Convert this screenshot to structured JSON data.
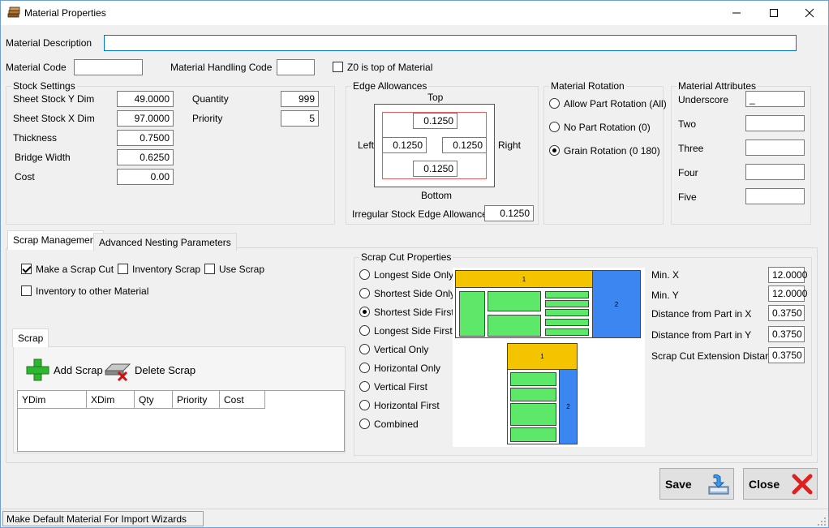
{
  "window": {
    "title": "Material Properties"
  },
  "material": {
    "description_label": "Material Description",
    "description_value": "",
    "code_label": "Material Code",
    "code_value": "",
    "handling_label": "Material Handling Code",
    "handling_value": "",
    "z0_label": "Z0 is top of Material"
  },
  "stock": {
    "title": "Stock Settings",
    "y_dim_label": "Sheet Stock Y Dim",
    "y_dim": "49.0000",
    "x_dim_label": "Sheet Stock X Dim",
    "x_dim": "97.0000",
    "thickness_label": "Thickness",
    "thickness": "0.7500",
    "bridge_label": "Bridge Width",
    "bridge": "0.6250",
    "cost_label": "Cost",
    "cost": "0.00",
    "quantity_label": "Quantity",
    "quantity": "999",
    "priority_label": "Priority",
    "priority": "5"
  },
  "edge": {
    "title": "Edge Allowances",
    "top_label": "Top",
    "bottom_label": "Bottom",
    "left_label": "Left",
    "right_label": "Right",
    "top": "0.1250",
    "left": "0.1250",
    "right": "0.1250",
    "bottom": "0.1250",
    "irregular_label": "Irregular Stock Edge Allowance",
    "irregular": "0.1250"
  },
  "rotation": {
    "title": "Material Rotation",
    "options": [
      "Allow Part Rotation (All)",
      "No Part Rotation (0)",
      "Grain Rotation (0 180)"
    ]
  },
  "attributes": {
    "title": "Material Attributes",
    "labels": [
      "Underscore",
      "Two",
      "Three",
      "Four",
      "Five"
    ],
    "values": [
      "_",
      "",
      "",
      "",
      ""
    ]
  },
  "tabs": [
    "Scrap Management",
    "Advanced Nesting Parameters"
  ],
  "scrap_mgmt": {
    "make_scrap_cut": "Make a Scrap Cut",
    "inventory_scrap": "Inventory Scrap",
    "use_scrap": "Use Scrap",
    "inventory_other": "Inventory to other Material",
    "scrap_tab": "Scrap",
    "add_scrap": "Add Scrap",
    "delete_scrap": "Delete Scrap",
    "columns": [
      "YDim",
      "XDim",
      "Qty",
      "Priority",
      "Cost"
    ]
  },
  "scrap_cut": {
    "title": "Scrap Cut Properties",
    "options": [
      "Longest Side Only",
      "Shortest Side Only",
      "Shortest Side First",
      "Longest Side First",
      "Vertical Only",
      "Horizontal Only",
      "Vertical First",
      "Horizontal First",
      "Combined"
    ],
    "diagram_labels": {
      "a1": "1",
      "a2": "2",
      "b1": "1",
      "b2": "2"
    },
    "min_x_label": "Min. X",
    "min_x": "12.0000",
    "min_y_label": "Min. Y",
    "min_y": "12.0000",
    "dist_x_label": "Distance from Part in X",
    "dist_x": "0.3750",
    "dist_y_label": "Distance from Part in Y",
    "dist_y": "0.3750",
    "ext_label": "Scrap Cut Extension Distance",
    "ext": "0.3750"
  },
  "buttons": {
    "save": "Save",
    "close": "Close"
  },
  "status": {
    "text": "Make Default Material For Import Wizards"
  },
  "colors": {
    "accent": "#0078d7",
    "scrap_yellow": "#f5c400",
    "scrap_blue": "#3b86f0",
    "part_green": "#5ee86a",
    "close_red": "#e02020"
  }
}
